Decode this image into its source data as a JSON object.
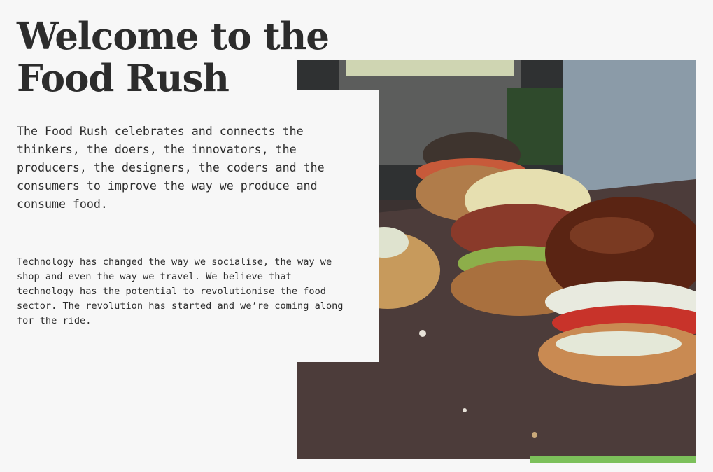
{
  "hero": {
    "title": "Welcome to the Food Rush",
    "lead": "The Food Rush celebrates and connects the thinkers, the doers, the innovators, the producers, the designers, the coders and the consumers to improve the way we produce and consume food.",
    "body": "Technology has changed the way we socialise, the way we shop and even the way we travel. We believe that technology has the potential to revolutionise the food sector. The revolution has started and we’re coming along for the ride."
  },
  "colors": {
    "background": "#f7f7f7",
    "text": "#2c2c2c",
    "accent": "#7cc05a"
  },
  "image": {
    "subject": "burgers-photo"
  }
}
